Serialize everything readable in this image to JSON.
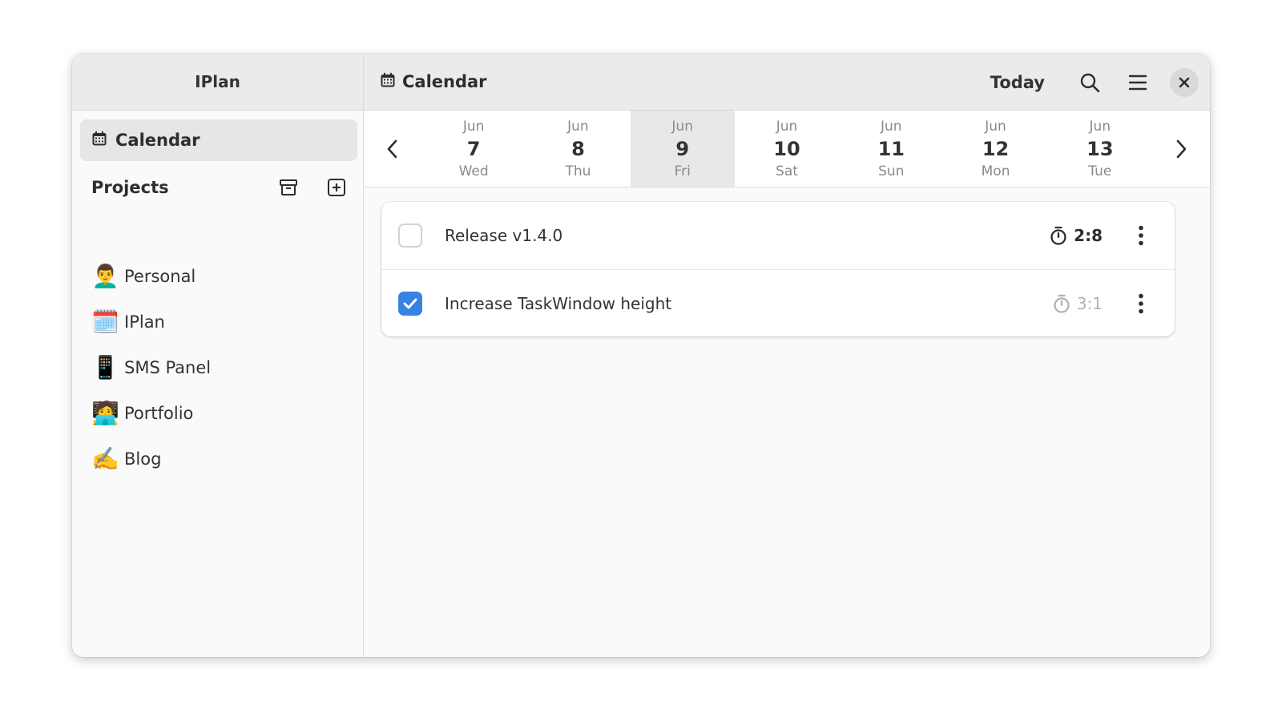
{
  "app": {
    "title": "IPlan"
  },
  "sidebar": {
    "calendar_label": "Calendar",
    "projects_title": "Projects",
    "projects": [
      {
        "emoji": "👨‍🦱",
        "name": "Personal"
      },
      {
        "emoji": "🗓️",
        "name": "IPlan"
      },
      {
        "emoji": "📱",
        "name": "SMS Panel"
      },
      {
        "emoji": "🧑‍💻",
        "name": "Portfolio"
      },
      {
        "emoji": "✍️",
        "name": "Blog"
      }
    ]
  },
  "header": {
    "title": "Calendar",
    "today_label": "Today"
  },
  "date_strip": {
    "days": [
      {
        "month": "Jun",
        "num": "7",
        "dow": "Wed",
        "selected": false
      },
      {
        "month": "Jun",
        "num": "8",
        "dow": "Thu",
        "selected": false
      },
      {
        "month": "Jun",
        "num": "9",
        "dow": "Fri",
        "selected": true
      },
      {
        "month": "Jun",
        "num": "10",
        "dow": "Sat",
        "selected": false
      },
      {
        "month": "Jun",
        "num": "11",
        "dow": "Sun",
        "selected": false
      },
      {
        "month": "Jun",
        "num": "12",
        "dow": "Mon",
        "selected": false
      },
      {
        "month": "Jun",
        "num": "13",
        "dow": "Tue",
        "selected": false
      }
    ]
  },
  "tasks": [
    {
      "name": "Release v1.4.0",
      "timer": "2:8",
      "done": false
    },
    {
      "name": "Increase TaskWindow height",
      "timer": "3:1",
      "done": true
    }
  ],
  "colors": {
    "accent": "#3584e4",
    "selected_day": "#e8e8e8"
  }
}
